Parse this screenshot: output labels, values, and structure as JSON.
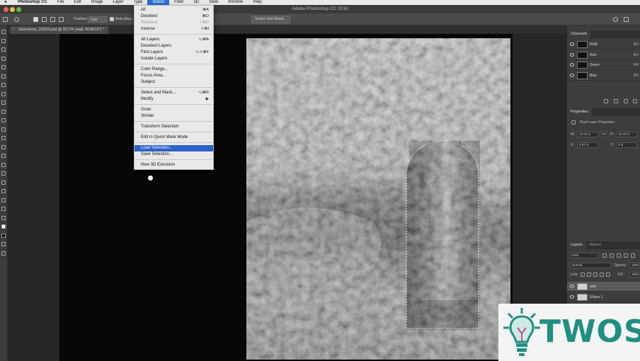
{
  "menubar": {
    "app": "Photoshop CC",
    "items": [
      "File",
      "Edit",
      "Image",
      "Layer",
      "Type",
      "Select",
      "Filter",
      "3D",
      "View",
      "Window",
      "Help"
    ],
    "active_index": 5
  },
  "window": {
    "title": "Adobe Photoshop CC 2019"
  },
  "options_bar": {
    "feather_label": "Feather:",
    "feather_value": "0 px",
    "antialias_label": "Anti-alias",
    "select_mask_button": "Select and Mask..."
  },
  "document": {
    "tab_title": "Selections_10333.psd @ 20.7% (wall, RGB/16*) *"
  },
  "select_menu": {
    "groups": [
      [
        {
          "label": "All",
          "shortcut": "⌘A",
          "disabled": false
        },
        {
          "label": "Deselect",
          "shortcut": "⌘D",
          "disabled": false
        },
        {
          "label": "Reselect",
          "shortcut": "⇧⌘D",
          "disabled": true
        },
        {
          "label": "Inverse",
          "shortcut": "⇧⌘I",
          "disabled": false
        }
      ],
      [
        {
          "label": "All Layers",
          "shortcut": "⌥⌘A",
          "disabled": false
        },
        {
          "label": "Deselect Layers",
          "shortcut": "",
          "disabled": false
        },
        {
          "label": "Find Layers",
          "shortcut": "⌥⇧⌘F",
          "disabled": false
        },
        {
          "label": "Isolate Layers",
          "shortcut": "",
          "disabled": false
        }
      ],
      [
        {
          "label": "Color Range...",
          "shortcut": "",
          "disabled": false
        },
        {
          "label": "Focus Area...",
          "shortcut": "",
          "disabled": false
        },
        {
          "label": "Subject",
          "shortcut": "",
          "disabled": false
        }
      ],
      [
        {
          "label": "Select and Mask...",
          "shortcut": "⌥⌘R",
          "disabled": false
        },
        {
          "label": "Modify",
          "shortcut": "▶",
          "disabled": false
        }
      ],
      [
        {
          "label": "Grow",
          "shortcut": "",
          "disabled": false
        },
        {
          "label": "Similar",
          "shortcut": "",
          "disabled": false
        }
      ],
      [
        {
          "label": "Transform Selection",
          "shortcut": "",
          "disabled": false
        }
      ],
      [
        {
          "label": "Edit in Quick Mask Mode",
          "shortcut": "",
          "disabled": false
        }
      ],
      [
        {
          "label": "Load Selection...",
          "shortcut": "",
          "disabled": false,
          "highlighted": true
        },
        {
          "label": "Save Selection...",
          "shortcut": "",
          "disabled": false
        }
      ],
      [
        {
          "label": "New 3D Extrusion",
          "shortcut": "",
          "disabled": false
        }
      ]
    ]
  },
  "channels_panel": {
    "tab": "Channels",
    "rows": [
      {
        "name": "RGB",
        "shortcut": "⌘2"
      },
      {
        "name": "Red",
        "shortcut": "⌘3"
      },
      {
        "name": "Green",
        "shortcut": "⌘4"
      },
      {
        "name": "Blue",
        "shortcut": "⌘5"
      }
    ]
  },
  "properties_panel": {
    "tab": "Properties",
    "subtitle": "Pixel Layer Properties",
    "w_label": "W:",
    "w_value": "12.43 in",
    "go_label": "GO",
    "h_label": "H:",
    "h_value": "18.18 in",
    "x_label": "X:",
    "x_value": "0.07 in",
    "y_label": "Y:",
    "y_value": "0 in"
  },
  "layers_panel": {
    "tabs": [
      "Layers",
      "History"
    ],
    "kind_label": "Kind",
    "blend_mode": "Normal",
    "opacity_label": "Opacity:",
    "opacity_value": "100%",
    "lock_label": "Lock:",
    "fill_label": "Fill:",
    "fill_value": "100%",
    "layers": [
      {
        "name": "wall",
        "selected": true
      },
      {
        "name": "Ellipse 1",
        "selected": false
      }
    ]
  },
  "watermark": {
    "text": "TWOS"
  },
  "colors": {
    "menu_highlight": "#2d63c8",
    "watermark_teal": "#1f8f82",
    "traffic_red": "#ec5f57",
    "traffic_yellow": "#e6be3a",
    "traffic_green": "#5fbe48"
  }
}
